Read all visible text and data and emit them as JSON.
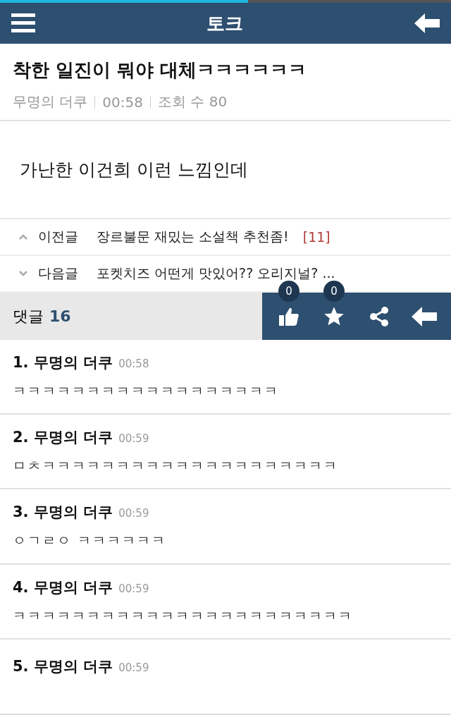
{
  "load_progress": {
    "level": 0.55
  },
  "header": {
    "title": "토크"
  },
  "post": {
    "title": "착한 일진이 뭐야 대체ㅋㅋㅋㅋㅋㅋ",
    "author": "무명의 더쿠",
    "time": "00:58",
    "views": "조회 수 80",
    "body": "가난한 이건희 이런 느낌인데"
  },
  "nav": [
    {
      "kind": "prev",
      "label": "이전글",
      "title": "장르불문 재밌는 소설책 추천좀!",
      "count": "[11]"
    },
    {
      "kind": "next",
      "label": "다음글",
      "title": "포켓치즈 어떤게 맛있어?? 오리지널? ..."
    }
  ],
  "comment_bar": {
    "label": "댓글",
    "count": "16",
    "likes": "0",
    "favorites": "0"
  },
  "comments": [
    {
      "number": "1.",
      "author": "무명의 더쿠",
      "time": "00:58",
      "text": "ㅋㅋㅋㅋㅋㅋㅋㅋㅋㅋㅋㅋㅋㅋㅋㅋㅋㅋ"
    },
    {
      "number": "2.",
      "author": "무명의 더쿠",
      "time": "00:59",
      "text": "ㅁㅊㅋㅋㅋㅋㅋㅋㅋㅋㅋㅋㅋㅋㅋㅋㅋㅋㅋㅋㅋㅋ"
    },
    {
      "number": "3.",
      "author": "무명의 더쿠",
      "time": "00:59",
      "text": "ㅇㄱㄹㅇ ㅋㅋㅋㅋㅋㅋ"
    },
    {
      "number": "4.",
      "author": "무명의 더쿠",
      "time": "00:59",
      "text": "ㅋㅋㅋㅋㅋㅋㅋㅋㅋㅋㅋㅋㅋㅋㅋㅋㅋㅋㅋㅋㅋㅋㅋ"
    },
    {
      "number": "5.",
      "author": "무명의 더쿠",
      "time": "00:59"
    }
  ]
}
